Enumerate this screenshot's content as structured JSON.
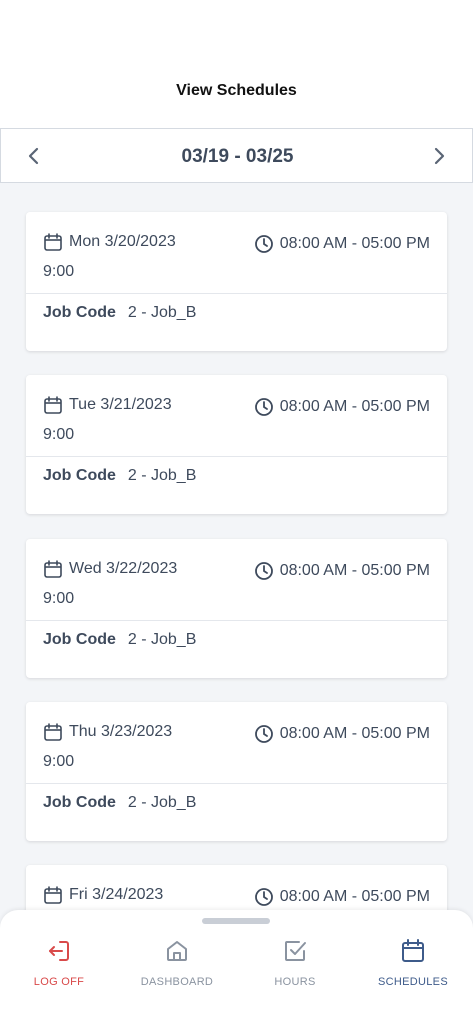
{
  "header": {
    "title": "View Schedules"
  },
  "week_nav": {
    "label": "03/19 - 03/25"
  },
  "schedules": [
    {
      "date": "Mon 3/20/2023",
      "time": "08:00 AM - 05:00 PM",
      "hours": "9:00",
      "job_label": "Job Code",
      "job_value": "2 - Job_B"
    },
    {
      "date": "Tue 3/21/2023",
      "time": "08:00 AM - 05:00 PM",
      "hours": "9:00",
      "job_label": "Job Code",
      "job_value": "2 - Job_B"
    },
    {
      "date": "Wed 3/22/2023",
      "time": "08:00 AM - 05:00 PM",
      "hours": "9:00",
      "job_label": "Job Code",
      "job_value": "2 - Job_B"
    },
    {
      "date": "Thu 3/23/2023",
      "time": "08:00 AM - 05:00 PM",
      "hours": "9:00",
      "job_label": "Job Code",
      "job_value": "2 - Job_B"
    },
    {
      "date": "Fri 3/24/2023",
      "time": "08:00 AM - 05:00 PM",
      "hours": "",
      "job_label": "",
      "job_value": ""
    }
  ],
  "tabs": [
    {
      "label": "LOG OFF",
      "icon": "log-off-icon",
      "color": "#d94a4a"
    },
    {
      "label": "DASHBOARD",
      "icon": "home-icon",
      "color": "#8a93a0"
    },
    {
      "label": "HOURS",
      "icon": "checkbox-icon",
      "color": "#8a93a0"
    },
    {
      "label": "SCHEDULES",
      "icon": "calendar-icon",
      "color": "#3e5b8a",
      "active": true
    }
  ]
}
